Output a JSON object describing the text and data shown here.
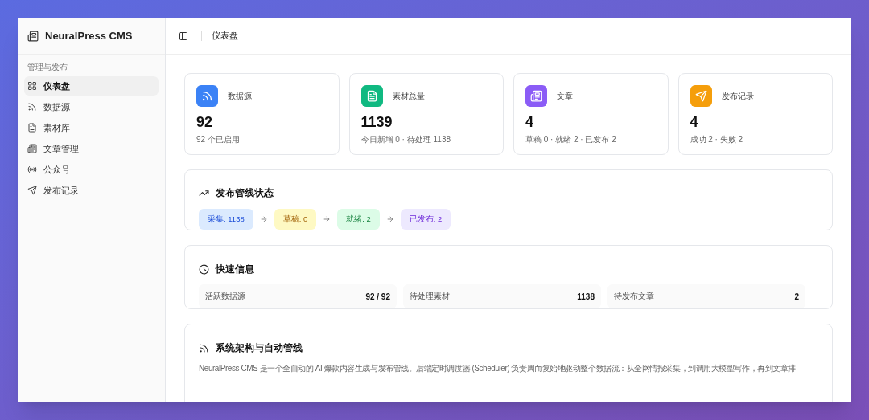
{
  "app": {
    "name": "NeuralPress CMS"
  },
  "sidebar": {
    "group_label": "管理与发布",
    "items": [
      {
        "label": "仪表盘",
        "selected": true
      },
      {
        "label": "数据源",
        "selected": false
      },
      {
        "label": "素材库",
        "selected": false
      },
      {
        "label": "文章管理",
        "selected": false
      },
      {
        "label": "公众号",
        "selected": false
      },
      {
        "label": "发布记录",
        "selected": false
      }
    ]
  },
  "header": {
    "title": "仪表盘"
  },
  "stats": [
    {
      "label": "数据源",
      "value": "92",
      "detail": "92 个已启用",
      "color": "#3b82f6"
    },
    {
      "label": "素材总量",
      "value": "1139",
      "detail": "今日新增 0 · 待处理 1138",
      "color": "#10b981"
    },
    {
      "label": "文章",
      "value": "4",
      "detail": "草稿 0 · 就绪 2 · 已发布 2",
      "color": "#8b5cf6"
    },
    {
      "label": "发布记录",
      "value": "4",
      "detail": "成功 2 · 失败 2",
      "color": "#f59e0b"
    }
  ],
  "pipeline": {
    "title": "发布管线状态",
    "stages": [
      {
        "label": "采集: 1138",
        "color": "#dbeafe"
      },
      {
        "label": "草稿: 0",
        "color": "#fef9c3"
      },
      {
        "label": "就绪: 2",
        "color": "#dcfce7"
      },
      {
        "label": "已发布: 2",
        "color": "#ede9fe"
      }
    ]
  },
  "quick_info": {
    "title": "快速信息",
    "items": [
      {
        "label": "活跃数据源",
        "value": "92 / 92"
      },
      {
        "label": "待处理素材",
        "value": "1138"
      },
      {
        "label": "待发布文章",
        "value": "2"
      }
    ]
  },
  "architecture": {
    "title": "系统架构与自动管线",
    "text": "NeuralPress CMS 是一个全自动的 AI 爆款内容生成与发布管线。后端定时调度器 (Scheduler) 负责周而复始地驱动整个数据流：从全网情报采集，到调用大模型写作，再到文章排"
  }
}
